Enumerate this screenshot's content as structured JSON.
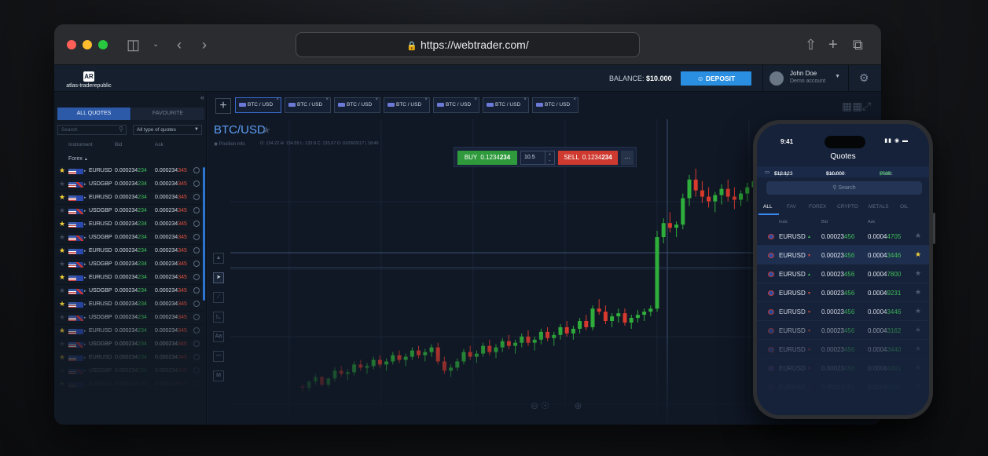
{
  "browser": {
    "url": "https://webtrader.com/"
  },
  "header": {
    "logo_text": "atlas-traderepublic",
    "balance_label": "BALANCE:",
    "balance_value": "$10.000",
    "deposit_label": "DEPOSIT",
    "user_name": "John Doe",
    "user_sub": "Demo account"
  },
  "sidebar": {
    "tab_all": "ALL QUOTES",
    "tab_fav": "FAVOURITE",
    "search_placeholder": "Search",
    "type_filter": "All type of quotes",
    "col_instrument": "Instrument",
    "col_bid": "Bid",
    "col_ask": "Ask",
    "group": "Forex",
    "rows": [
      {
        "fav": true,
        "flag2": "eu",
        "sym": "EURUSD",
        "bid_a": "0.000234",
        "bid_b": "234",
        "ask_a": "0.000234",
        "ask_b": "345"
      },
      {
        "fav": false,
        "flag2": "gb",
        "sym": "USDGBP",
        "bid_a": "0.000234",
        "bid_b": "234",
        "ask_a": "0.000234",
        "ask_b": "345"
      },
      {
        "fav": true,
        "flag2": "eu",
        "sym": "EURUSD",
        "bid_a": "0.000234",
        "bid_b": "234",
        "ask_a": "0.000234",
        "ask_b": "345"
      },
      {
        "fav": false,
        "flag2": "gb",
        "sym": "USDGBP",
        "bid_a": "0.000234",
        "bid_b": "234",
        "ask_a": "0.000234",
        "ask_b": "345"
      },
      {
        "fav": true,
        "flag2": "eu",
        "sym": "EURUSD",
        "bid_a": "0.000234",
        "bid_b": "234",
        "ask_a": "0.000234",
        "ask_b": "345"
      },
      {
        "fav": false,
        "flag2": "gb",
        "sym": "USDGBP",
        "bid_a": "0.000234",
        "bid_b": "234",
        "ask_a": "0.000234",
        "ask_b": "345"
      },
      {
        "fav": true,
        "flag2": "eu",
        "sym": "EURUSD",
        "bid_a": "0.000234",
        "bid_b": "234",
        "ask_a": "0.000234",
        "ask_b": "345"
      },
      {
        "fav": false,
        "flag2": "gb",
        "sym": "USDGBP",
        "bid_a": "0.000234",
        "bid_b": "234",
        "ask_a": "0.000234",
        "ask_b": "345"
      },
      {
        "fav": true,
        "flag2": "eu",
        "sym": "EURUSD",
        "bid_a": "0.000234",
        "bid_b": "234",
        "ask_a": "0.000234",
        "ask_b": "345"
      },
      {
        "fav": false,
        "flag2": "gb",
        "sym": "USDGBP",
        "bid_a": "0.000234",
        "bid_b": "234",
        "ask_a": "0.000234",
        "ask_b": "345"
      },
      {
        "fav": true,
        "flag2": "eu",
        "sym": "EURUSD",
        "bid_a": "0.000234",
        "bid_b": "234",
        "ask_a": "0.000234",
        "ask_b": "345"
      },
      {
        "fav": false,
        "flag2": "gb",
        "sym": "USDGBP",
        "bid_a": "0.000234",
        "bid_b": "234",
        "ask_a": "0.000234",
        "ask_b": "345"
      },
      {
        "fav": true,
        "flag2": "eu",
        "sym": "EURUSD",
        "bid_a": "0.000234",
        "bid_b": "234",
        "ask_a": "0.000234",
        "ask_b": "345"
      },
      {
        "fav": false,
        "flag2": "gb",
        "sym": "USDGBP",
        "bid_a": "0.000234",
        "bid_b": "234",
        "ask_a": "0.000234",
        "ask_b": "345"
      },
      {
        "fav": true,
        "flag2": "eu",
        "sym": "EURUSD",
        "bid_a": "0.000234",
        "bid_b": "234",
        "ask_a": "0.000234",
        "ask_b": "345"
      },
      {
        "fav": false,
        "flag2": "gb",
        "sym": "USDGBP",
        "bid_a": "0.000234",
        "bid_b": "234",
        "ask_a": "0.000234",
        "ask_b": "345"
      },
      {
        "fav": true,
        "flag2": "eu",
        "sym": "EURUSD",
        "bid_a": "0.000234",
        "bid_b": "234",
        "ask_a": "0.000234",
        "ask_b": "345"
      }
    ]
  },
  "chart_tabs": [
    "BTC / USD",
    "BTC / USD",
    "BTC / USD",
    "BTC / USD",
    "BTC / USD",
    "BTC / USD",
    "BTC / USD"
  ],
  "chart_header": {
    "pair": "BTC/USD",
    "position_info": "Position info",
    "ohlc": "O: 134.22  H: 134.55  L: 133.8  C: 133.67  D: 01/09/2017 | 18:46"
  },
  "trade": {
    "buy_label": "BUY",
    "buy_price_a": "0.1234",
    "buy_price_b": "234",
    "quantity": "10.5",
    "sell_label": "SELL",
    "sell_price_a": "0.1234",
    "sell_price_b": "234",
    "more": "..."
  },
  "tool_icons": [
    "mountain-chart-icon",
    "cursor-icon",
    "trend-line-icon",
    "fib-icon",
    "text-icon",
    "indicator-icon",
    "measure-icon"
  ],
  "chart_data": {
    "type": "candlestick",
    "colors": {
      "up": "#2fae3b",
      "down": "#d83a2e"
    },
    "candles": [
      [
        100,
        102,
        96,
        99
      ],
      [
        99,
        104,
        97,
        103
      ],
      [
        103,
        108,
        101,
        106
      ],
      [
        106,
        107,
        100,
        101
      ],
      [
        101,
        106,
        99,
        105
      ],
      [
        105,
        112,
        103,
        110
      ],
      [
        110,
        113,
        106,
        108
      ],
      [
        108,
        111,
        104,
        109
      ],
      [
        109,
        116,
        107,
        114
      ],
      [
        114,
        117,
        110,
        112
      ],
      [
        112,
        115,
        108,
        113
      ],
      [
        113,
        119,
        111,
        117
      ],
      [
        117,
        120,
        112,
        114
      ],
      [
        114,
        118,
        110,
        116
      ],
      [
        116,
        122,
        114,
        120
      ],
      [
        120,
        123,
        115,
        117
      ],
      [
        117,
        121,
        113,
        119
      ],
      [
        119,
        125,
        117,
        123
      ],
      [
        123,
        126,
        118,
        120
      ],
      [
        120,
        124,
        116,
        122
      ],
      [
        122,
        127,
        119,
        125
      ],
      [
        125,
        128,
        114,
        116
      ],
      [
        116,
        119,
        108,
        110
      ],
      [
        110,
        114,
        106,
        112
      ],
      [
        112,
        118,
        110,
        116
      ],
      [
        116,
        124,
        114,
        122
      ],
      [
        122,
        126,
        117,
        119
      ],
      [
        119,
        123,
        115,
        121
      ],
      [
        121,
        128,
        119,
        126
      ],
      [
        126,
        130,
        120,
        122
      ],
      [
        122,
        127,
        118,
        125
      ],
      [
        125,
        131,
        122,
        129
      ],
      [
        129,
        133,
        124,
        126
      ],
      [
        126,
        130,
        121,
        128
      ],
      [
        128,
        134,
        125,
        132
      ],
      [
        132,
        136,
        126,
        128
      ],
      [
        128,
        132,
        123,
        130
      ],
      [
        130,
        137,
        127,
        135
      ],
      [
        135,
        138,
        129,
        131
      ],
      [
        131,
        135,
        126,
        133
      ],
      [
        133,
        140,
        130,
        138
      ],
      [
        138,
        142,
        132,
        134
      ],
      [
        134,
        139,
        130,
        137
      ],
      [
        137,
        144,
        134,
        142
      ],
      [
        142,
        146,
        136,
        138
      ],
      [
        138,
        152,
        136,
        150
      ],
      [
        150,
        156,
        146,
        148
      ],
      [
        148,
        152,
        140,
        142
      ],
      [
        142,
        147,
        138,
        145
      ],
      [
        145,
        150,
        141,
        147
      ],
      [
        147,
        150,
        139,
        141
      ],
      [
        141,
        146,
        137,
        144
      ],
      [
        144,
        149,
        141,
        146
      ],
      [
        146,
        150,
        142,
        148
      ],
      [
        148,
        152,
        145,
        150
      ],
      [
        150,
        200,
        148,
        196
      ],
      [
        196,
        208,
        192,
        205
      ],
      [
        205,
        212,
        199,
        202
      ],
      [
        202,
        206,
        196,
        204
      ],
      [
        204,
        224,
        201,
        221
      ],
      [
        221,
        236,
        216,
        233
      ],
      [
        233,
        240,
        222,
        226
      ],
      [
        226,
        232,
        218,
        222
      ],
      [
        222,
        228,
        215,
        219
      ],
      [
        219,
        225,
        212,
        223
      ],
      [
        223,
        230,
        217,
        227
      ],
      [
        227,
        233,
        219,
        222
      ],
      [
        222,
        228,
        214,
        220
      ],
      [
        220,
        226,
        216,
        224
      ],
      [
        224,
        231,
        219,
        228
      ],
      [
        228,
        236,
        222,
        232
      ],
      [
        232,
        238,
        224,
        227
      ],
      [
        227,
        233,
        221,
        230
      ],
      [
        230,
        238,
        226,
        235
      ],
      [
        235,
        243,
        230,
        239
      ],
      [
        239,
        244,
        232,
        236
      ],
      [
        236,
        241,
        230,
        238
      ],
      [
        238,
        244,
        233,
        240
      ],
      [
        240,
        242,
        229,
        232
      ],
      [
        232,
        237,
        227,
        235
      ],
      [
        235,
        241,
        230,
        237
      ],
      [
        237,
        239,
        222,
        225
      ],
      [
        225,
        230,
        208,
        212
      ]
    ]
  },
  "phone": {
    "time": "9:41",
    "title": "Quotes",
    "equity_label": "Equity:",
    "equity_value": "$12.123",
    "balance_label": "Balance:",
    "balance_value": "$10.000",
    "profit_label": "Profit:",
    "profit_value": "$568",
    "search_placeholder": "Search",
    "tabs": [
      "ALL",
      "FAV",
      "FOREX",
      "CRYPTO",
      "METALS",
      "OIL"
    ],
    "col_instr": "Instr.",
    "col_bid": "Bid",
    "col_ask": "Ask",
    "rows": [
      {
        "sym": "EURUSD",
        "dir": "up",
        "bid_a": "0.00023",
        "bid_b": "456",
        "ask_a": "0.0004",
        "ask_b": "4705",
        "fav": false,
        "sel": false
      },
      {
        "sym": "EURUSD",
        "dir": "down",
        "bid_a": "0.00023",
        "bid_b": "456",
        "ask_a": "0.0004",
        "ask_b": "3446",
        "fav": true,
        "sel": true
      },
      {
        "sym": "EURUSD",
        "dir": "up",
        "bid_a": "0.00023",
        "bid_b": "456",
        "ask_a": "0.0004",
        "ask_b": "7800",
        "fav": false,
        "sel": false
      },
      {
        "sym": "EURUSD",
        "dir": "down",
        "bid_a": "0.00023",
        "bid_b": "456",
        "ask_a": "0.0004",
        "ask_b": "9231",
        "fav": false,
        "sel": false
      },
      {
        "sym": "EURUSD",
        "dir": "down",
        "bid_a": "0.00023",
        "bid_b": "456",
        "ask_a": "0.0004",
        "ask_b": "3446",
        "fav": false,
        "sel": false
      },
      {
        "sym": "EURUSD",
        "dir": "down",
        "bid_a": "0.00023",
        "bid_b": "456",
        "ask_a": "0.0004",
        "ask_b": "3162",
        "fav": false,
        "sel": false
      },
      {
        "sym": "EURUSD",
        "dir": "down",
        "bid_a": "0.00023",
        "bid_b": "456",
        "ask_a": "0.0004",
        "ask_b": "3440",
        "fav": false,
        "sel": false
      },
      {
        "sym": "EURUSD",
        "dir": "down",
        "bid_a": "0.00023",
        "bid_b": "456",
        "ask_a": "0.0004",
        "ask_b": "4401",
        "fav": false,
        "sel": false
      },
      {
        "sym": "EURUSD",
        "dir": "down",
        "bid_a": "0.00023",
        "bid_b": "456",
        "ask_a": "0.0004",
        "ask_b": "3440",
        "fav": false,
        "sel": false
      }
    ]
  }
}
